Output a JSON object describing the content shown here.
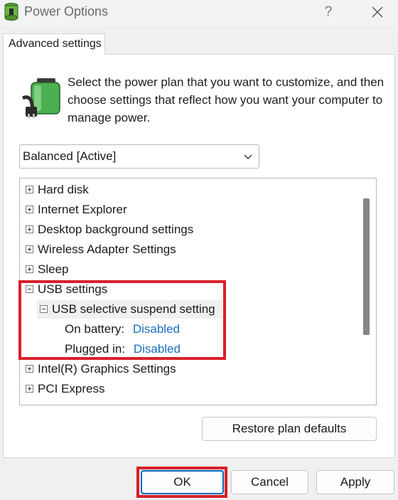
{
  "window": {
    "title": "Power Options",
    "help_label": "?",
    "icon": "power-options-icon"
  },
  "tab": {
    "label": "Advanced settings"
  },
  "description": "Select the power plan that you want to customize, and then choose settings that reflect how you want your computer to manage power.",
  "plan_select": {
    "value": "Balanced [Active]"
  },
  "tree": {
    "items": [
      {
        "label": "Hard disk",
        "expander": "+"
      },
      {
        "label": "Internet Explorer",
        "expander": "+"
      },
      {
        "label": "Desktop background settings",
        "expander": "+"
      },
      {
        "label": "Wireless Adapter Settings",
        "expander": "+"
      },
      {
        "label": "Sleep",
        "expander": "+"
      },
      {
        "label": "USB settings",
        "expander": "-"
      },
      {
        "label": "USB selective suspend setting",
        "expander": "-"
      },
      {
        "label": "On battery:",
        "value": "Disabled"
      },
      {
        "label": "Plugged in:",
        "value": "Disabled"
      },
      {
        "label": "Intel(R) Graphics Settings",
        "expander": "+"
      },
      {
        "label": "PCI Express",
        "expander": "+"
      }
    ]
  },
  "buttons": {
    "restore": "Restore plan defaults",
    "ok": "OK",
    "cancel": "Cancel",
    "apply": "Apply"
  },
  "colors": {
    "highlight": "#d9202a",
    "link": "#1a6cc0",
    "focus": "#0067c0"
  }
}
